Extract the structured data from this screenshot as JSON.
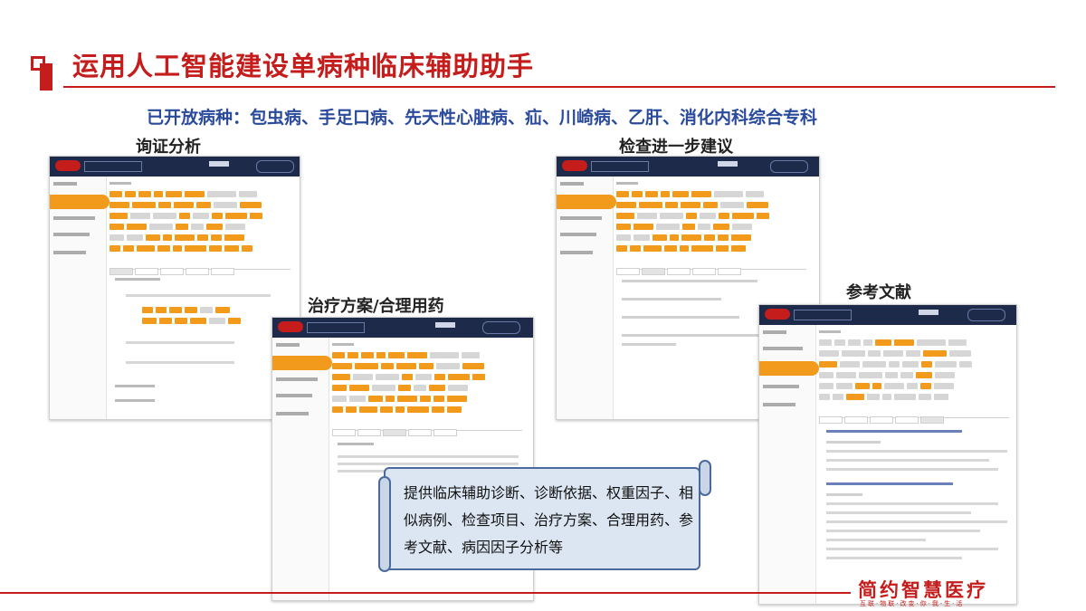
{
  "header": {
    "title": "运用人工智能建设单病种临床辅助助手",
    "subtitle": "已开放病种：包虫病、手足口病、先天性心脏病、疝、川崎病、乙肝、消化内科综合专科"
  },
  "sections": {
    "inquiry": "询证分析",
    "exam": "检查进一步建议",
    "treatment": "治疗方案/合理用药",
    "reference": "参考文献"
  },
  "callout": {
    "text": "提供临床辅助诊断、诊断依据、权重因子、相似病例、检查项目、治疗方案、合理用药、参考文献、病因因子分析等"
  },
  "brand": {
    "name": "简约智慧医疗",
    "slogan": "互联·物联·改变·你·我·生·活"
  },
  "colors": {
    "accent": "#c51c1c",
    "subtitle": "#2a4a9c",
    "tag": "#f19a1c",
    "app_header": "#1e2a4a"
  }
}
